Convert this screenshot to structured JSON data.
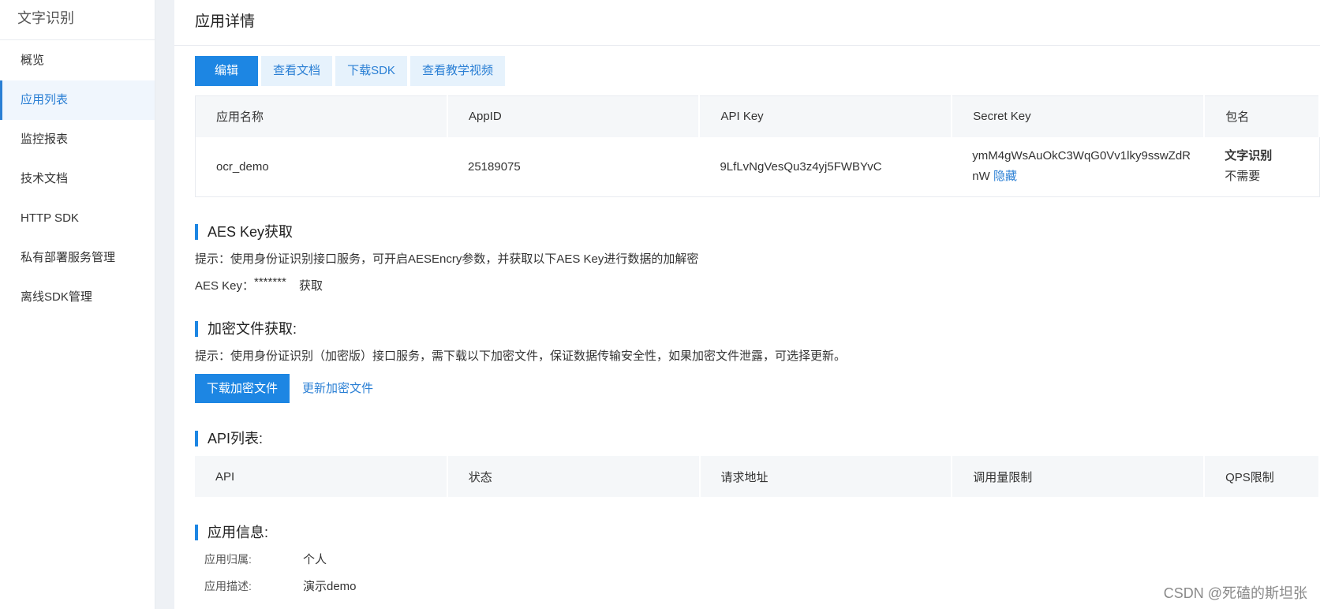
{
  "sidebar": {
    "title": "文字识别",
    "items": [
      {
        "label": "概览"
      },
      {
        "label": "应用列表"
      },
      {
        "label": "监控报表"
      },
      {
        "label": "技术文档"
      },
      {
        "label": "HTTP SDK"
      },
      {
        "label": "私有部署服务管理"
      },
      {
        "label": "离线SDK管理"
      }
    ],
    "active_index": 1
  },
  "page": {
    "title": "应用详情",
    "buttons": [
      "编辑",
      "查看文档",
      "下载SDK",
      "查看教学视频"
    ]
  },
  "app_table": {
    "headers": [
      "应用名称",
      "AppID",
      "API Key",
      "Secret Key",
      "包名"
    ],
    "row": {
      "name": "ocr_demo",
      "appid": "25189075",
      "api_key": "9LfLvNgVesQu3z4yj5FWBYvC",
      "secret_key_line1": "ymM4gWsAuOkC3WqG0Vv1lky9sswZdR",
      "secret_key_line2": "nW",
      "hide_label": "隐藏",
      "package_name": "文字识别",
      "package_value": "不需要"
    }
  },
  "aes": {
    "heading": "AES Key获取",
    "hint": "提示：使用身份证识别接口服务，可开启AESEncry参数，并获取以下AES Key进行数据的加解密",
    "label": "AES Key：",
    "value": "*******",
    "fetch_label": "获取"
  },
  "encrypt": {
    "heading": "加密文件获取:",
    "hint": "提示：使用身份证识别（加密版）接口服务，需下载以下加密文件，保证数据传输安全性，如果加密文件泄露，可选择更新。",
    "download_label": "下载加密文件",
    "update_label": "更新加密文件"
  },
  "api_list": {
    "heading": "API列表:",
    "headers": [
      "API",
      "状态",
      "请求地址",
      "调用量限制",
      "QPS限制"
    ]
  },
  "app_info": {
    "heading": "应用信息:",
    "owner_label": "应用归属:",
    "owner_value": "个人",
    "desc_label": "应用描述:",
    "desc_value": "演示demo"
  },
  "watermark": "CSDN @死磕的斯坦张",
  "colors": {
    "accent": "#1d86e3",
    "link": "#2a7fd4",
    "tint": "#e6f2fc"
  }
}
